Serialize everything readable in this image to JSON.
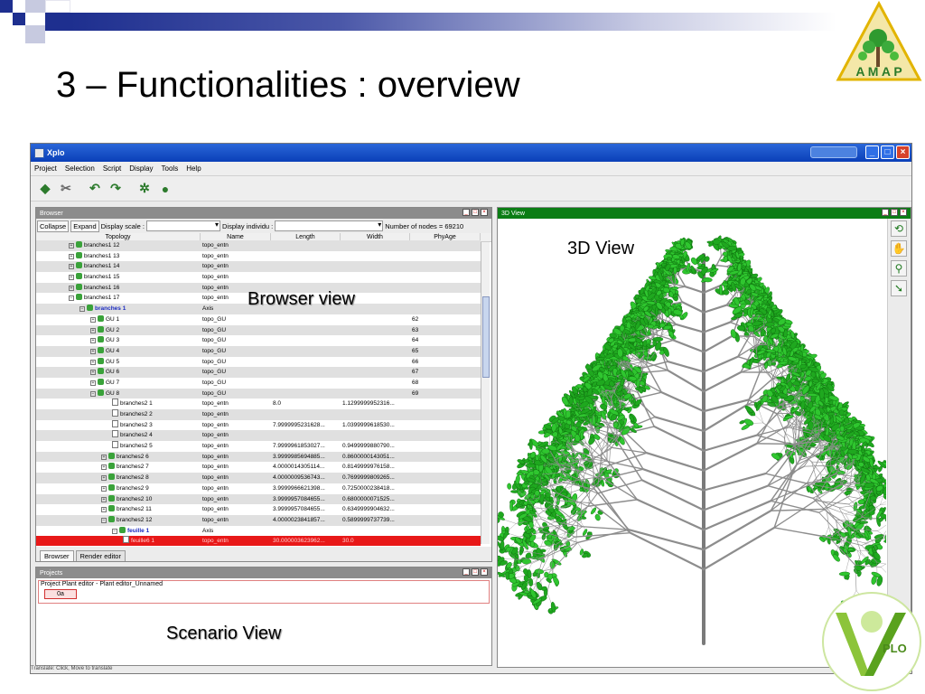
{
  "slide": {
    "title": "3 – Functionalities : overview",
    "labels": {
      "view3d": "3D  View",
      "browser": "Browser view",
      "scenario": "Scenario View"
    },
    "logos": {
      "amap": "A M A P",
      "xplo": "PLO"
    }
  },
  "app": {
    "title": "Xplo",
    "menu": [
      "Project",
      "Selection",
      "Script",
      "Display",
      "Tools",
      "Help"
    ],
    "toolbar_icons": [
      "open-icon",
      "cut-icon",
      "undo-icon",
      "redo-icon",
      "tree-icon",
      "play-icon"
    ],
    "browser": {
      "panel_title": "Browser",
      "collapse_label": "Collapse",
      "expand_label": "Expand",
      "display_scale_label": "Display scale :",
      "display_individu_label": "Display individu :",
      "node_count": "Number of nodes = 69210",
      "columns": [
        "Topology",
        "Name",
        "Length",
        "Width",
        "PhyAge"
      ],
      "rows": [
        {
          "indent": 3,
          "icon": "plus",
          "node": "branches1 12",
          "name": "topo_entn",
          "length": "",
          "width": "",
          "phy": ""
        },
        {
          "indent": 3,
          "icon": "plus",
          "node": "branches1 13",
          "name": "topo_entn",
          "length": "",
          "width": "",
          "phy": ""
        },
        {
          "indent": 3,
          "icon": "plus",
          "node": "branches1 14",
          "name": "topo_entn",
          "length": "",
          "width": "",
          "phy": ""
        },
        {
          "indent": 3,
          "icon": "plus",
          "node": "branches1 15",
          "name": "topo_entn",
          "length": "",
          "width": "",
          "phy": ""
        },
        {
          "indent": 3,
          "icon": "plus",
          "node": "branches1 16",
          "name": "topo_entn",
          "length": "",
          "width": "",
          "phy": ""
        },
        {
          "indent": 3,
          "icon": "minus",
          "node": "branches1 17",
          "name": "topo_entn",
          "length": "",
          "width": "",
          "phy": ""
        },
        {
          "indent": 4,
          "icon": "minus",
          "node": "branches 1",
          "name": "Axis",
          "length": "",
          "width": "",
          "phy": "",
          "bold": true
        },
        {
          "indent": 5,
          "icon": "plus",
          "node": "GU 1",
          "name": "topo_GU",
          "length": "",
          "width": "",
          "phy": "62"
        },
        {
          "indent": 5,
          "icon": "plus",
          "node": "GU 2",
          "name": "topo_GU",
          "length": "",
          "width": "",
          "phy": "63"
        },
        {
          "indent": 5,
          "icon": "plus",
          "node": "GU 3",
          "name": "topo_GU",
          "length": "",
          "width": "",
          "phy": "64"
        },
        {
          "indent": 5,
          "icon": "plus",
          "node": "GU 4",
          "name": "topo_GU",
          "length": "",
          "width": "",
          "phy": "65"
        },
        {
          "indent": 5,
          "icon": "plus",
          "node": "GU 5",
          "name": "topo_GU",
          "length": "",
          "width": "",
          "phy": "66"
        },
        {
          "indent": 5,
          "icon": "plus",
          "node": "GU 6",
          "name": "topo_GU",
          "length": "",
          "width": "",
          "phy": "67"
        },
        {
          "indent": 5,
          "icon": "plus",
          "node": "GU 7",
          "name": "topo_GU",
          "length": "",
          "width": "",
          "phy": "68"
        },
        {
          "indent": 5,
          "icon": "minus",
          "node": "GU 8",
          "name": "topo_GU",
          "length": "",
          "width": "",
          "phy": "69"
        },
        {
          "indent": 7,
          "icon": "leaf",
          "node": "branches2 1",
          "name": "topo_entn",
          "length": "8.0",
          "width": "1.1299999952316...",
          "phy": ""
        },
        {
          "indent": 7,
          "icon": "leaf",
          "node": "branches2 2",
          "name": "topo_entn",
          "length": "",
          "width": "",
          "phy": ""
        },
        {
          "indent": 7,
          "icon": "leaf",
          "node": "branches2 3",
          "name": "topo_entn",
          "length": "7.9999995231628...",
          "width": "1.0399999618530...",
          "phy": ""
        },
        {
          "indent": 7,
          "icon": "leaf",
          "node": "branches2 4",
          "name": "topo_entn",
          "length": "",
          "width": "",
          "phy": ""
        },
        {
          "indent": 7,
          "icon": "leaf",
          "node": "branches2 5",
          "name": "topo_entn",
          "length": "7.9999961853027...",
          "width": "0.9499999880790...",
          "phy": ""
        },
        {
          "indent": 6,
          "icon": "plus",
          "node": "branches2 6",
          "name": "topo_entn",
          "length": "3.9999985694885...",
          "width": "0.8600000143051...",
          "phy": ""
        },
        {
          "indent": 6,
          "icon": "plus",
          "node": "branches2 7",
          "name": "topo_entn",
          "length": "4.0000014305114...",
          "width": "0.8149999976158...",
          "phy": ""
        },
        {
          "indent": 6,
          "icon": "plus",
          "node": "branches2 8",
          "name": "topo_entn",
          "length": "4.0000009536743...",
          "width": "0.7699999809265...",
          "phy": ""
        },
        {
          "indent": 6,
          "icon": "plus",
          "node": "branches2 9",
          "name": "topo_entn",
          "length": "3.9999966621398...",
          "width": "0.7250000238418...",
          "phy": ""
        },
        {
          "indent": 6,
          "icon": "plus",
          "node": "branches2 10",
          "name": "topo_entn",
          "length": "3.9999957084655...",
          "width": "0.6800000071525...",
          "phy": ""
        },
        {
          "indent": 6,
          "icon": "plus",
          "node": "branches2 11",
          "name": "topo_entn",
          "length": "3.9999957084655...",
          "width": "0.6349999904632...",
          "phy": ""
        },
        {
          "indent": 6,
          "icon": "minus",
          "node": "branches2 12",
          "name": "topo_entn",
          "length": "4.0000023841857...",
          "width": "0.5899999737739...",
          "phy": ""
        },
        {
          "indent": 7,
          "icon": "minus",
          "node": "feuille 1",
          "name": "Axis",
          "length": "",
          "width": "",
          "phy": "",
          "bold": true
        },
        {
          "indent": 8,
          "icon": "leaf",
          "node": "feuille6 1",
          "name": "topo_entn",
          "length": "30.000003623962...",
          "width": "30.0",
          "phy": "",
          "selected": true
        }
      ],
      "tabs": [
        "Browser",
        "Render editor"
      ]
    },
    "projects": {
      "panel_title": "Projects",
      "line": "Project Plant editor  -  Plant editor_Unnamed",
      "item": "0a"
    },
    "view3d": {
      "panel_title": "3D View",
      "tool_icons": [
        "rotate-icon",
        "pan-hand-icon",
        "zoom-icon",
        "select-arrow-icon"
      ]
    },
    "status": "Translate: Click, Move to translate"
  },
  "colors": {
    "accent_blue": "#0a3fb8",
    "view_green": "#0b7d14",
    "selection_red": "#e81818"
  }
}
